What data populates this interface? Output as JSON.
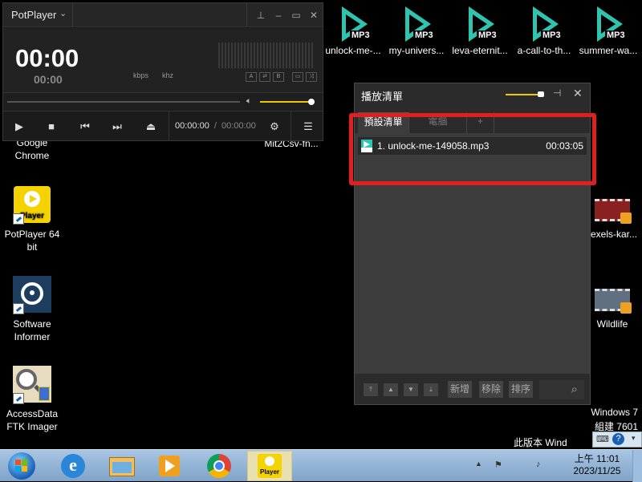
{
  "desktop": {
    "mp3_files": [
      {
        "label": "unlock-me-...",
        "badge": "MP3"
      },
      {
        "label": "my-univers...",
        "badge": "MP3"
      },
      {
        "label": "leva-eternit...",
        "badge": "MP3"
      },
      {
        "label": "a-call-to-th...",
        "badge": "MP3"
      },
      {
        "label": "summer-wa...",
        "badge": "MP3"
      }
    ],
    "left_icons": [
      {
        "label": "Google\nChrome"
      },
      {
        "label": "PotPlayer 64\nbit",
        "tile_text": "Player"
      },
      {
        "label": "Software\nInformer"
      },
      {
        "label": "AccessData\nFTK Imager"
      }
    ],
    "partial_label_top": "Mit2Csv-fn...",
    "right_icons": [
      {
        "label": "exels-kar..."
      },
      {
        "label": "Wildlife"
      }
    ],
    "watermark": {
      "line1": "Windows 7",
      "line2": "組建 7601",
      "line3": "此版本 Wind"
    }
  },
  "potplayer": {
    "brand": "PotPlayer",
    "time_main": "00:00",
    "time_sub": "00:00",
    "kbps": "kbps",
    "khz": "khz",
    "mini_buttons": [
      "A",
      "⇄",
      "B",
      "▭",
      "⤨"
    ],
    "volume_level": 1.0,
    "seek_progress": 0.0,
    "current_time": "00:00:00",
    "duration": "00:00:00",
    "separator": "/"
  },
  "playlist": {
    "title": "播放清單",
    "tabs": [
      "預設清單",
      "電腦",
      "+"
    ],
    "active_tab": "預設清單",
    "items": [
      {
        "name": "1. unlock-me-149058.mp3",
        "duration": "00:03:05"
      }
    ],
    "buttons": {
      "add": "新增",
      "remove": "移除",
      "sort": "排序"
    },
    "volume_level": 0.9
  },
  "taskbar": {
    "pinned": [
      "start",
      "internet-explorer",
      "file-explorer",
      "media-player",
      "chrome",
      "potplayer"
    ],
    "potplayer_tile_text": "Player",
    "clock_time": "上午 11:01",
    "clock_date": "2023/11/25"
  },
  "colors": {
    "accent_yellow": "#f0c800",
    "highlight_red": "#e02020",
    "teal_play": "#2ec4b0"
  }
}
